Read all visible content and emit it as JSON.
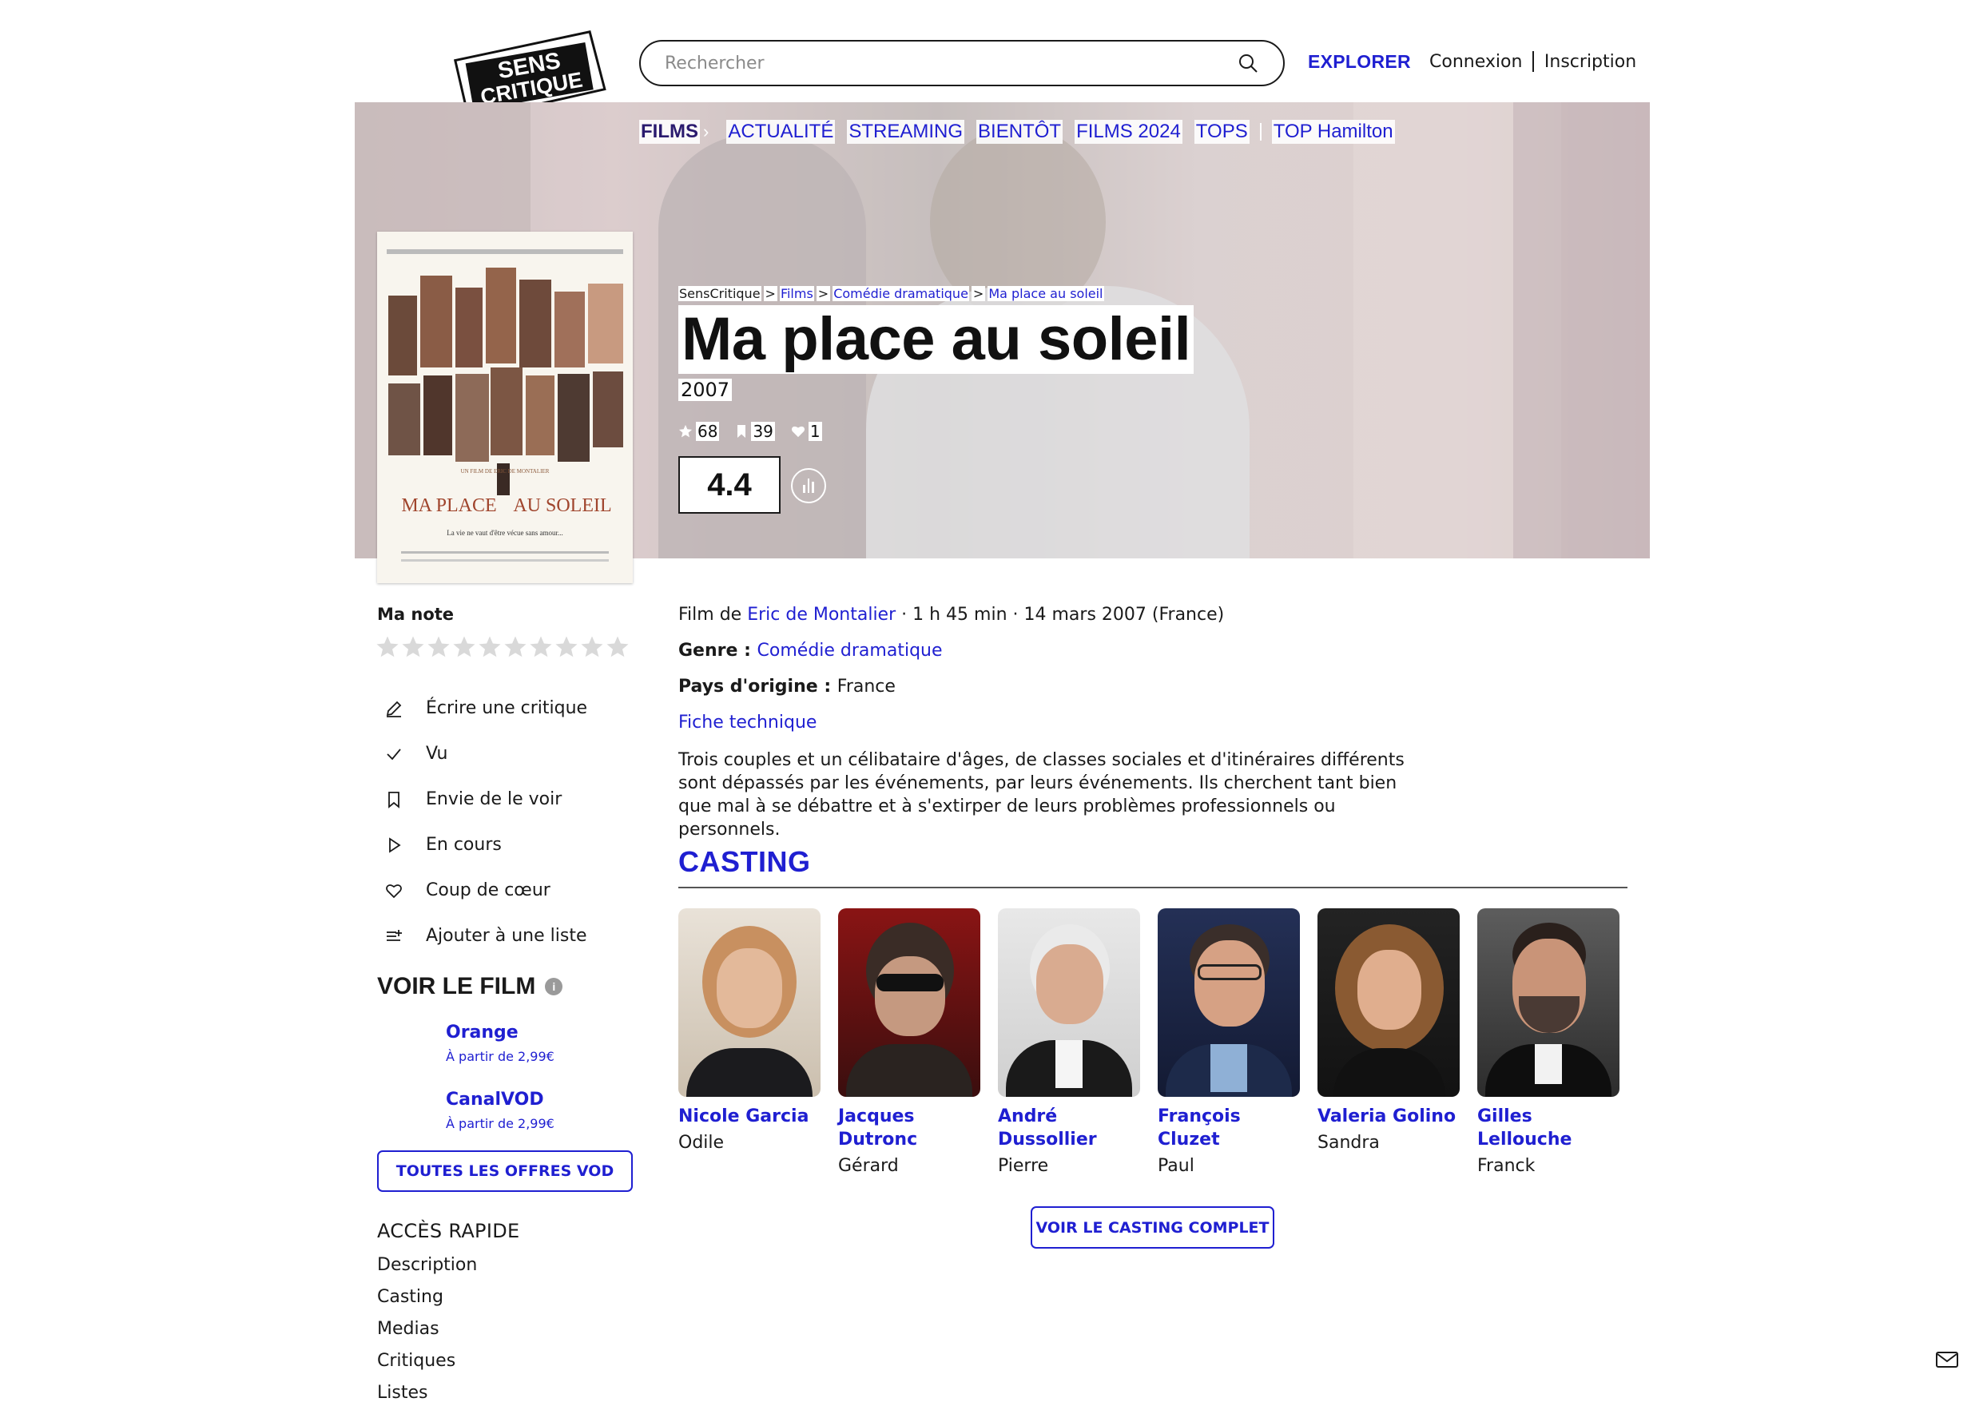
{
  "header": {
    "logo_line1": "SENS",
    "logo_line2": "CRITIQUE",
    "search_placeholder": "Rechercher",
    "explorer": "EXPLORER",
    "login": "Connexion",
    "signup": "Inscription"
  },
  "nav": {
    "section": "FILMS",
    "items": [
      "ACTUALITÉ",
      "STREAMING",
      "BIENTÔT",
      "FILMS 2024",
      "TOPS"
    ],
    "extra": "TOP Hamilton"
  },
  "breadcrumb": [
    "SensCritique",
    "Films",
    "Comédie dramatique",
    "Ma place au soleil"
  ],
  "breadcrumb_separator": ">",
  "movie": {
    "title": "Ma place au soleil",
    "year": "2007",
    "ratings_count": "68",
    "wishes_count": "39",
    "favorites_count": "1",
    "score": "4.4",
    "poster_subtitle": "UN FILM DE ERIC DE MONTALIER",
    "poster_title_left": "MA PLACE",
    "poster_title_right": "AU SOLEIL",
    "poster_tagline": "La vie ne vaut d'être vécue sans amour..."
  },
  "sidebar": {
    "my_note_label": "Ma note",
    "star_count": 10,
    "actions": [
      {
        "icon": "pencil-icon",
        "label": "Écrire une critique"
      },
      {
        "icon": "check-icon",
        "label": "Vu"
      },
      {
        "icon": "bookmark-icon",
        "label": "Envie de le voir"
      },
      {
        "icon": "play-icon",
        "label": "En cours"
      },
      {
        "icon": "heart-icon",
        "label": "Coup de cœur"
      },
      {
        "icon": "list-add-icon",
        "label": "Ajouter à une liste"
      }
    ],
    "watch_title": "VOIR LE FILM",
    "info_glyph": "i",
    "offers": [
      {
        "name": "Orange",
        "price": "À partir de 2,99€"
      },
      {
        "name": "CanalVOD",
        "price": "À partir de 2,99€"
      }
    ],
    "all_offers_button": "TOUTES LES OFFRES VOD",
    "quick_access_title": "ACCÈS RAPIDE",
    "quick_links": [
      "Description",
      "Casting",
      "Medias",
      "Critiques",
      "Listes"
    ]
  },
  "details": {
    "film_by_prefix": "Film de ",
    "director": "Eric de Montalier",
    "meta": " · 1 h 45 min · 14 mars 2007 (France)",
    "genre_label": "Genre : ",
    "genre": "Comédie dramatique",
    "country_label": "Pays d'origine : ",
    "country": "France",
    "tech_sheet": "Fiche technique",
    "synopsis": "Trois couples et un célibataire d'âges, de classes sociales et d'itinéraires différents sont dépassés par les événements, par leurs événements. Ils cherchent tant bien que mal à se débattre et à s'extirper de leurs problèmes professionnels ou personnels."
  },
  "casting": {
    "title": "CASTING",
    "actors": [
      {
        "name": "Nicole Garcia",
        "role": "Odile"
      },
      {
        "name": "Jacques Dutronc",
        "role": "Gérard"
      },
      {
        "name": "André Dussollier",
        "role": "Pierre"
      },
      {
        "name": "François Cluzet",
        "role": "Paul"
      },
      {
        "name": "Valeria Golino",
        "role": "Sandra"
      },
      {
        "name": "Gilles Lellouche",
        "role": "Franck"
      }
    ],
    "full_cast_button": "VOIR LE CASTING COMPLET"
  },
  "colors": {
    "accent": "#1f1fd1",
    "text": "#1a1a1a",
    "nav_section": "#2a1a6e"
  }
}
